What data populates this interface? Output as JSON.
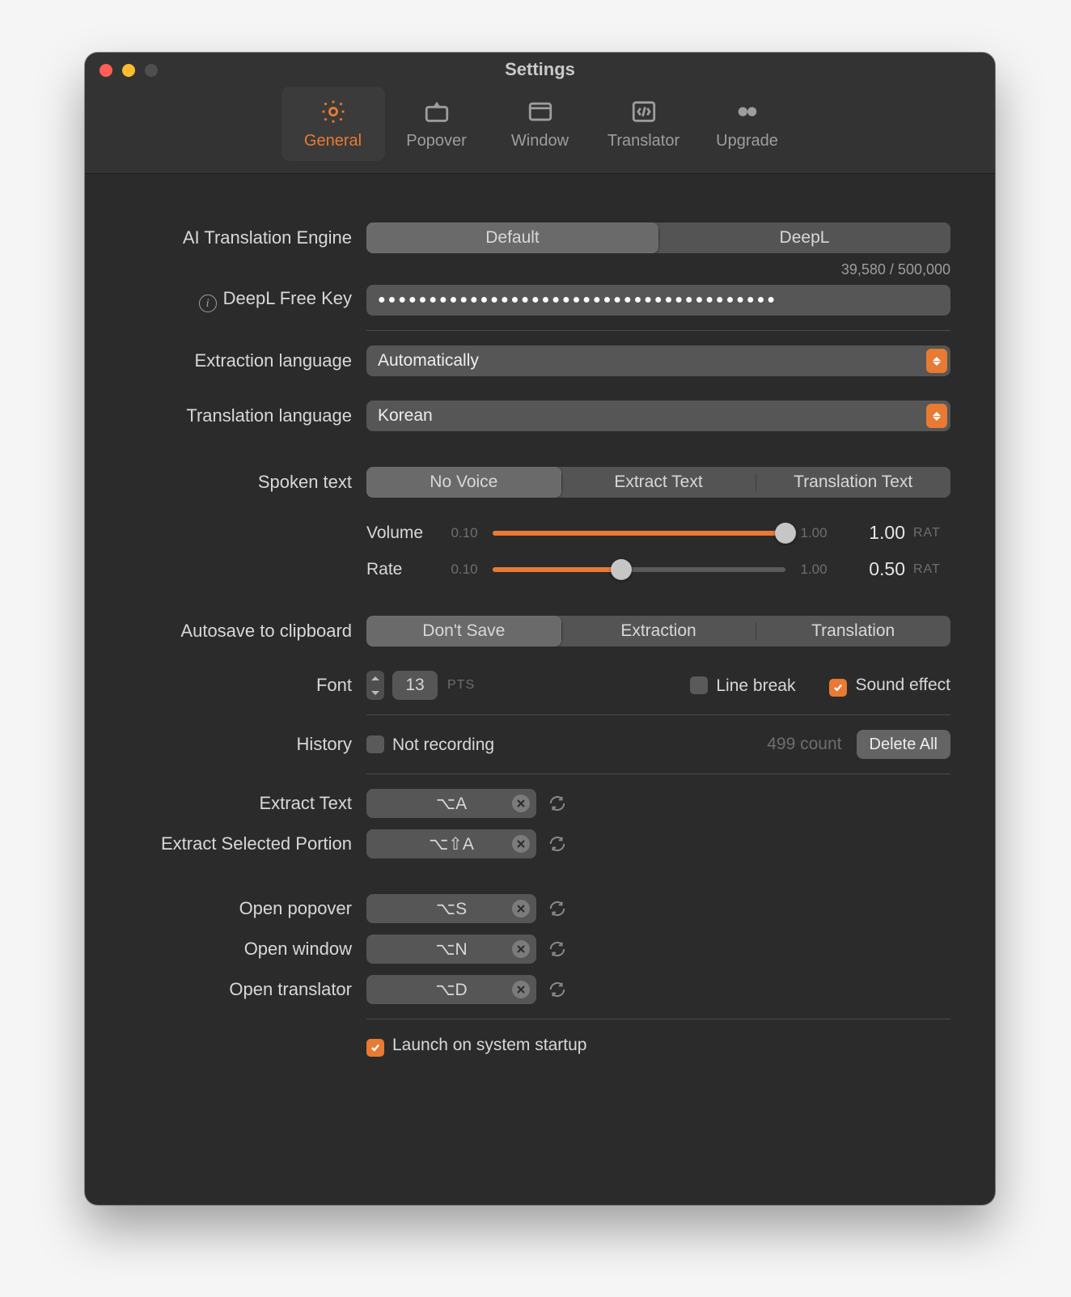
{
  "window": {
    "title": "Settings"
  },
  "tabs": {
    "general": "General",
    "popover": "Popover",
    "window": "Window",
    "translator": "Translator",
    "upgrade": "Upgrade",
    "selected": "general"
  },
  "engine": {
    "label": "AI Translation Engine",
    "options": {
      "default": "Default",
      "deepl": "DeepL"
    },
    "selected": "default"
  },
  "deeplKey": {
    "label": "DeepL Free Key",
    "value_masked": "●●●●●●●●●●●●●●●●●●●●●●●●●●●●●●●●●●●●●●●",
    "usage": "39,580 / 500,000"
  },
  "extractLang": {
    "label": "Extraction language",
    "value": "Automatically"
  },
  "transLang": {
    "label": "Translation language",
    "value": "Korean"
  },
  "spoken": {
    "label": "Spoken text",
    "options": {
      "novoice": "No Voice",
      "extract": "Extract Text",
      "translation": "Translation Text"
    },
    "selected": "novoice"
  },
  "volume": {
    "label": "Volume",
    "min": "0.10",
    "max": "1.00",
    "value": "1.00",
    "unit": "RAT",
    "fillPct": 100
  },
  "rate": {
    "label": "Rate",
    "min": "0.10",
    "max": "1.00",
    "value": "0.50",
    "unit": "RAT",
    "fillPct": 44
  },
  "autosave": {
    "label": "Autosave to clipboard",
    "options": {
      "dont": "Don't Save",
      "extraction": "Extraction",
      "translation": "Translation"
    },
    "selected": "dont"
  },
  "font": {
    "label": "Font",
    "value": "13",
    "unit": "PTS"
  },
  "lineBreak": {
    "label": "Line break",
    "checked": false
  },
  "soundEffect": {
    "label": "Sound effect",
    "checked": true
  },
  "history": {
    "label": "History",
    "notRecording": {
      "label": "Not recording",
      "checked": false
    },
    "countText": "499 count",
    "deleteAll": "Delete All"
  },
  "shortcuts": {
    "extractText": {
      "label": "Extract Text",
      "value": "⌥A"
    },
    "extractSelected": {
      "label": "Extract Selected Portion",
      "value": "⌥⇧A"
    },
    "openPopover": {
      "label": "Open popover",
      "value": "⌥S"
    },
    "openWindow": {
      "label": "Open window",
      "value": "⌥N"
    },
    "openTranslator": {
      "label": "Open translator",
      "value": "⌥D"
    }
  },
  "launchStartup": {
    "label": "Launch on system startup",
    "checked": true
  }
}
